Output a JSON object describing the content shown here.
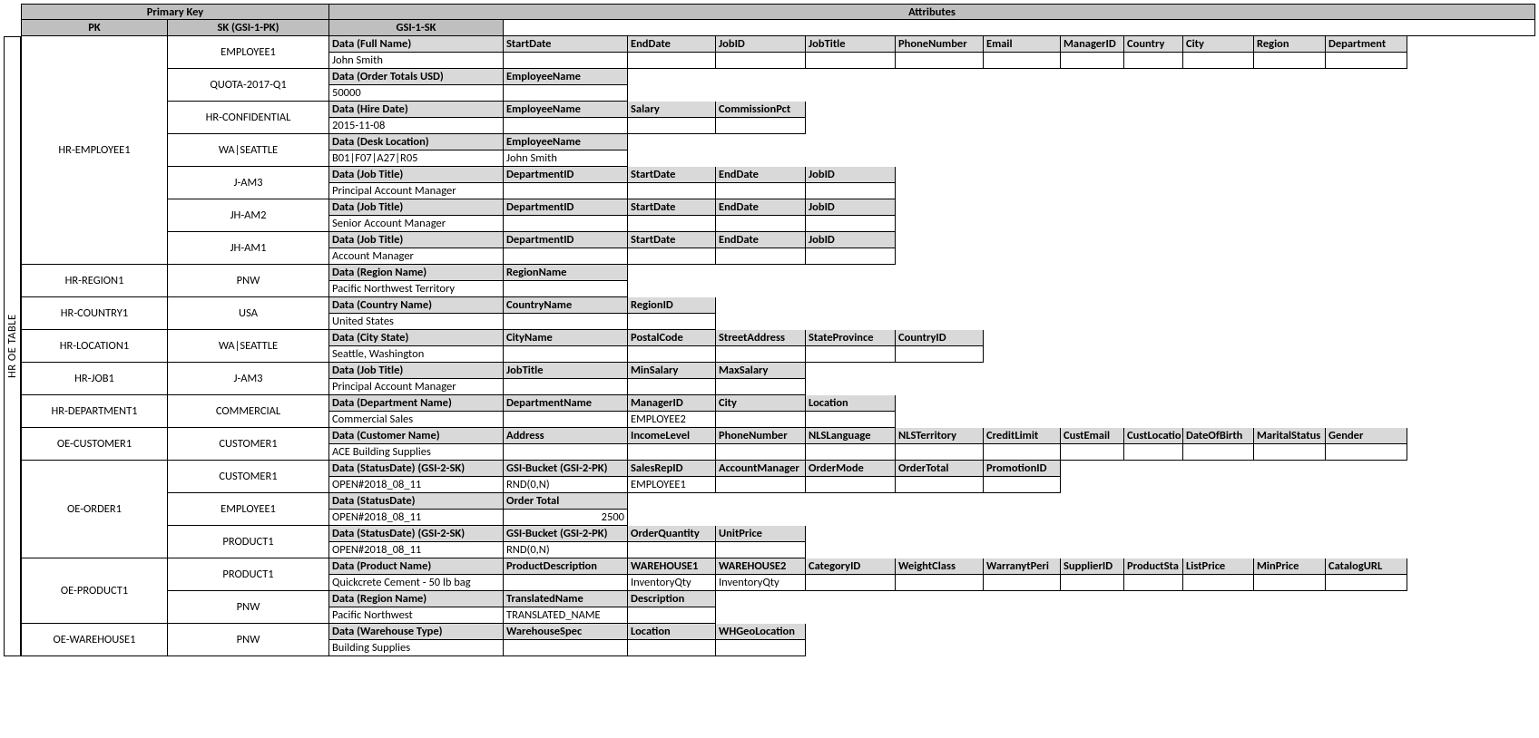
{
  "vtab_label": "HR OE TABLE",
  "header": {
    "pk_span": "Primary Key",
    "attr_span": "Attributes",
    "pk": "PK",
    "sk": "SK (GSI-1-PK)",
    "gsi": "GSI-1-SK"
  },
  "colw": {
    "c0": 192,
    "c1": 137,
    "c2": 97,
    "c3": 99,
    "c4": 99,
    "c5": 97,
    "c6": 85,
    "c7": 70,
    "c8": 65,
    "c9": 78,
    "c10": 79,
    "c11": 90,
    "c12": 74
  },
  "pk_groups": [
    {
      "pk": "HR-EMPLOYEE1",
      "sks": [
        {
          "sk": "EMPLOYEE1",
          "head": [
            "Data (Full Name)",
            "StartDate",
            "EndDate",
            "JobID",
            "JobTitle",
            "PhoneNumber",
            "Email",
            "ManagerID",
            "Country",
            "City",
            "Region",
            "Department"
          ],
          "vals": [
            "John Smith",
            "",
            "",
            "",
            "",
            "",
            "",
            "",
            "",
            "",
            "",
            ""
          ],
          "span": 12
        },
        {
          "sk": "QUOTA-2017-Q1",
          "head": [
            "Data (Order Totals USD)",
            "EmployeeName"
          ],
          "vals": [
            "50000",
            ""
          ],
          "span": 2
        },
        {
          "sk": "HR-CONFIDENTIAL",
          "head": [
            "Data (Hire Date)",
            "EmployeeName",
            "Salary",
            "CommissionPct"
          ],
          "vals": [
            "2015-11-08",
            "",
            "",
            ""
          ],
          "span": 4
        },
        {
          "sk": "WA|SEATTLE",
          "head": [
            "Data (Desk Location)",
            "EmployeeName"
          ],
          "vals": [
            "B01|F07|A27|R05",
            "John Smith"
          ],
          "span": 2
        },
        {
          "sk": "J-AM3",
          "head": [
            "Data (Job Title)",
            "DepartmentID",
            "StartDate",
            "EndDate",
            "JobID"
          ],
          "vals": [
            "Principal Account Manager",
            "",
            "",
            "",
            ""
          ],
          "span": 5
        },
        {
          "sk": "JH-AM2",
          "head": [
            "Data (Job Title)",
            "DepartmentID",
            "StartDate",
            "EndDate",
            "JobID"
          ],
          "vals": [
            "Senior Account Manager",
            "",
            "",
            "",
            ""
          ],
          "span": 5
        },
        {
          "sk": "JH-AM1",
          "head": [
            "Data (Job Title)",
            "DepartmentID",
            "StartDate",
            "EndDate",
            "JobID"
          ],
          "vals": [
            "Account Manager",
            "",
            "",
            "",
            ""
          ],
          "span": 5
        }
      ]
    },
    {
      "pk": "HR-REGION1",
      "sks": [
        {
          "sk": "PNW",
          "head": [
            "Data (Region Name)",
            "RegionName"
          ],
          "vals": [
            "Pacific Northwest Territory",
            ""
          ],
          "span": 2
        }
      ]
    },
    {
      "pk": "HR-COUNTRY1",
      "sks": [
        {
          "sk": "USA",
          "head": [
            "Data (Country Name)",
            "CountryName",
            "RegionID"
          ],
          "vals": [
            "United States",
            "",
            ""
          ],
          "span": 3
        }
      ]
    },
    {
      "pk": "HR-LOCATION1",
      "sks": [
        {
          "sk": "WA|SEATTLE",
          "head": [
            "Data (City State)",
            "CityName",
            "PostalCode",
            "StreetAddress",
            "StateProvince",
            "CountryID"
          ],
          "vals": [
            "Seattle, Washington",
            "",
            "",
            "",
            "",
            ""
          ],
          "span": 6
        }
      ]
    },
    {
      "pk": "HR-JOB1",
      "sks": [
        {
          "sk": "J-AM3",
          "head": [
            "Data (Job Title)",
            "JobTitle",
            "MinSalary",
            "MaxSalary"
          ],
          "vals": [
            "Principal Account Manager",
            "",
            "",
            ""
          ],
          "span": 4
        }
      ]
    },
    {
      "pk": "HR-DEPARTMENT1",
      "sks": [
        {
          "sk": "COMMERCIAL",
          "head": [
            "Data (Department Name)",
            "DepartmentName",
            "ManagerID",
            "City",
            "Location"
          ],
          "vals": [
            "Commercial Sales",
            "",
            "EMPLOYEE2",
            "",
            ""
          ],
          "span": 5
        }
      ]
    },
    {
      "pk": "OE-CUSTOMER1",
      "sks": [
        {
          "sk": "CUSTOMER1",
          "head": [
            "Data (Customer Name)",
            "Address",
            "IncomeLevel",
            "PhoneNumber",
            "NLSLanguage",
            "NLSTerritory",
            "CreditLimit",
            "CustEmail",
            "CustLocatio",
            "DateOfBirth",
            "MaritalStatus",
            "Gender"
          ],
          "vals": [
            "ACE Building Supplies",
            "",
            "",
            "",
            "",
            "",
            "",
            "",
            "",
            "",
            "",
            ""
          ],
          "span": 12
        }
      ]
    },
    {
      "pk": "OE-ORDER1",
      "sks": [
        {
          "sk": "CUSTOMER1",
          "head": [
            "Data (StatusDate) (GSI-2-SK)",
            "GSI-Bucket (GSI-2-PK)",
            "SalesRepID",
            "AccountManager",
            "OrderMode",
            "OrderTotal",
            "PromotionID"
          ],
          "vals": [
            "OPEN#2018_08_11",
            "RND(0,N)",
            "EMPLOYEE1",
            "",
            "",
            "",
            ""
          ],
          "span": 7
        },
        {
          "sk": "EMPLOYEE1",
          "head": [
            "Data (StatusDate)",
            "Order Total"
          ],
          "vals": [
            "OPEN#2018_08_11",
            "2500"
          ],
          "span": 2,
          "align_right_idx": 1
        },
        {
          "sk": "PRODUCT1",
          "head": [
            "Data (StatusDate) (GSI-2-SK)",
            "GSI-Bucket (GSI-2-PK)",
            "OrderQuantity",
            "UnitPrice"
          ],
          "vals": [
            "OPEN#2018_08_11",
            "RND(0,N)",
            "",
            ""
          ],
          "span": 4
        }
      ]
    },
    {
      "pk": "OE-PRODUCT1",
      "sks": [
        {
          "sk": "PRODUCT1",
          "head": [
            "Data (Product Name)",
            "ProductDescription",
            "WAREHOUSE1",
            "WAREHOUSE2",
            "CategoryID",
            "WeightClass",
            "WarranytPeri",
            "SupplierID",
            "ProductSta",
            "ListPrice",
            "MinPrice",
            "CatalogURL"
          ],
          "vals": [
            "Quickcrete Cement - 50 lb bag",
            "",
            "InventoryQty",
            "InventoryQty",
            "",
            "",
            "",
            "",
            "",
            "",
            "",
            ""
          ],
          "span": 12
        },
        {
          "sk": "PNW",
          "head": [
            "Data (Region Name)",
            "TranslatedName",
            "Description"
          ],
          "vals": [
            "Pacific Northwest",
            "TRANSLATED_NAME",
            ""
          ],
          "span": 3
        }
      ]
    },
    {
      "pk": "OE-WAREHOUSE1",
      "sks": [
        {
          "sk": "PNW",
          "head": [
            "Data (Warehouse Type)",
            "WarehouseSpec",
            "Location",
            "WHGeoLocation"
          ],
          "vals": [
            "Building Supplies",
            "",
            "",
            ""
          ],
          "span": 4
        }
      ]
    }
  ]
}
